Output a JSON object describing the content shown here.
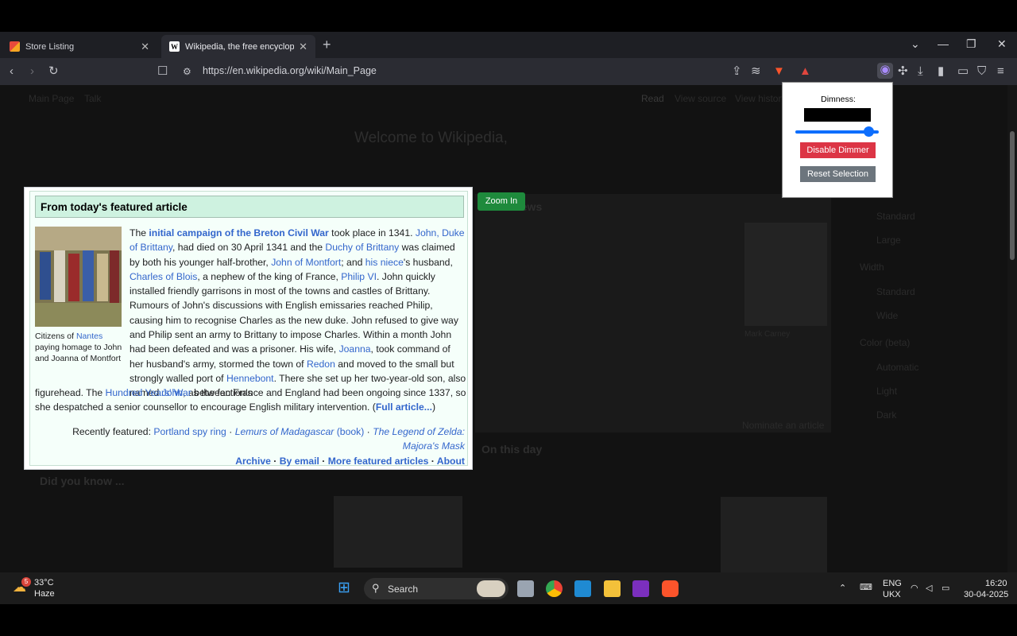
{
  "tabs": [
    {
      "title": "Store Listing",
      "close": "✕"
    },
    {
      "title": "Wikipedia, the free encyclopedia",
      "close": "✕"
    }
  ],
  "new_tab": "+",
  "window_controls": [
    "⌄",
    "—",
    "❐",
    "✕"
  ],
  "address": {
    "url": "https://en.wikipedia.org/wiki/Main_Page"
  },
  "background_page": {
    "tabs_left": [
      "Main Page",
      "Talk"
    ],
    "tabs_right": [
      "Read",
      "View source",
      "View history"
    ],
    "welcome": "Welcome to Wikipedia,",
    "in_the_news": "In the news",
    "did_you_know": "Did you know ...",
    "on_this_day": "On this day",
    "nominate": "Nominate an article",
    "appearance": [
      "Standard",
      "Large",
      "Width",
      "Standard",
      "Wide",
      "Color (beta)",
      "Automatic",
      "Light",
      "Dark"
    ],
    "news_caption": "Mark Carney"
  },
  "featured": {
    "heading": "From today's featured article",
    "caption_pre": "Citizens of ",
    "caption_link": "Nantes",
    "caption_post": " paying homage to John and Joanna of Montfort",
    "recently_label": "Recently featured:",
    "recent": [
      "Portland spy ring",
      "Lemurs of Madagascar",
      "(book)",
      "The Legend of Zelda: Majora's",
      "Mask"
    ],
    "footer": [
      "Archive",
      "By email",
      "More featured articles",
      "About"
    ]
  },
  "zoom_button": "Zoom In",
  "dimmer_popup": {
    "label": "Dimness:",
    "color": "#000000",
    "level": 0.93,
    "disable_label": "Disable Dimmer",
    "reset_label": "Reset Selection"
  },
  "taskbar": {
    "weather_temp": "33°C",
    "weather_desc": "Haze",
    "weather_badge": "5",
    "search_placeholder": "Search",
    "lang1": "ENG",
    "lang2": "UKX",
    "time": "16:20",
    "date": "30-04-2025"
  }
}
